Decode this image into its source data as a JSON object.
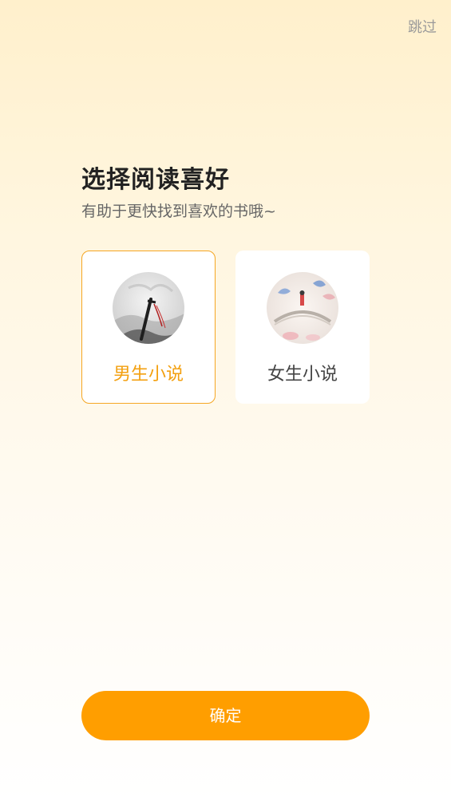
{
  "header": {
    "skip_label": "跳过"
  },
  "intro": {
    "title": "选择阅读喜好",
    "subtitle": "有助于更快找到喜欢的书哦~"
  },
  "options": [
    {
      "label": "男生小说",
      "selected": true
    },
    {
      "label": "女生小说",
      "selected": false
    }
  ],
  "footer": {
    "confirm_label": "确定"
  },
  "colors": {
    "accent": "#ff9e00",
    "selected_text": "#f3a010",
    "selected_border": "#f5a623"
  }
}
